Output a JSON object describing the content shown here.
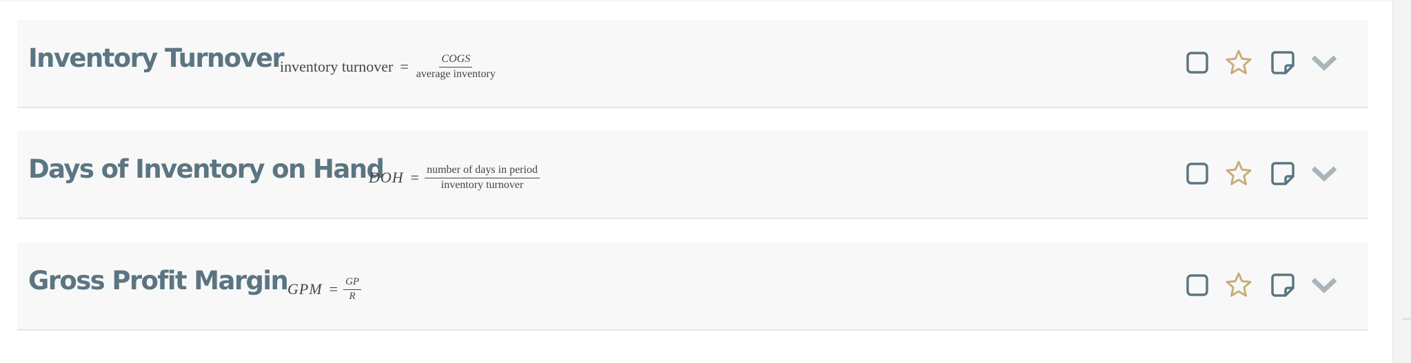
{
  "cards": [
    {
      "title": "Inventory Turnover",
      "formula": {
        "lhs": "inventory turnover",
        "eq": "=",
        "numerator": "COGS",
        "denominator": "average inventory"
      }
    },
    {
      "title": "Days of Inventory on Hand",
      "formula": {
        "lhs": "DOH",
        "eq": "=",
        "numerator": "number of days in period",
        "denominator": "inventory turnover"
      }
    },
    {
      "title": "Gross Profit Margin",
      "formula": {
        "lhs": "GPM",
        "eq": "=",
        "numerator": "GP",
        "denominator": "R"
      }
    }
  ],
  "icons": {
    "checkbox": "checkbox-icon",
    "favorite": "star-icon",
    "note": "note-icon",
    "expand": "chevron-down-icon"
  },
  "colors": {
    "title": "#5b7582",
    "icon_slate": "#5b7582",
    "star": "#c8ad7a",
    "chevron": "#a9b5bb",
    "card_bg": "#f8f8f8"
  }
}
